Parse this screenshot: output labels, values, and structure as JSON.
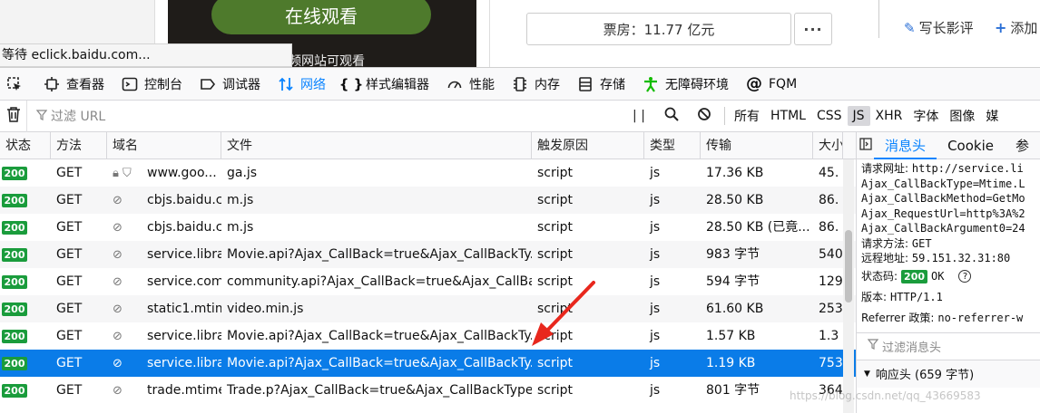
{
  "page": {
    "watch_button": "在线观看",
    "poster_text": "频网站可观看",
    "status_text": "等待 eclick.baidu.com...",
    "box_office": "票房：11.77 亿元",
    "more": "···",
    "write_review": "写长影评",
    "add": "添加"
  },
  "devtools": {
    "tabs": [
      {
        "label": "查看器",
        "icon": "inspector-icon"
      },
      {
        "label": "控制台",
        "icon": "console-icon"
      },
      {
        "label": "调试器",
        "icon": "debugger-icon"
      },
      {
        "label": "网络",
        "icon": "network-icon",
        "active": true
      },
      {
        "label": "样式编辑器",
        "icon": "style-editor-icon"
      },
      {
        "label": "性能",
        "icon": "performance-icon"
      },
      {
        "label": "内存",
        "icon": "memory-icon"
      },
      {
        "label": "存储",
        "icon": "storage-icon"
      },
      {
        "label": "无障碍环境",
        "icon": "accessibility-icon"
      },
      {
        "label": "FQM",
        "icon": "fqm-icon"
      }
    ],
    "filter_placeholder": "过滤 URL",
    "type_filters": [
      "所有",
      "HTML",
      "CSS",
      "JS",
      "XHR",
      "字体",
      "图像",
      "媒"
    ],
    "active_type_filter": "JS",
    "columns": [
      "状态",
      "方法",
      "域名",
      "文件",
      "触发原因",
      "类型",
      "传输",
      "大小"
    ],
    "rows": [
      {
        "status": "200",
        "method": "GET",
        "domain": "www.goo...",
        "file": "ga.js",
        "cause": "script",
        "type": "js",
        "transfer": "17.36 KB",
        "size": "45."
      },
      {
        "status": "200",
        "method": "GET",
        "domain": "cbjs.baidu.c...",
        "file": "m.js",
        "cause": "script",
        "type": "js",
        "transfer": "28.50 KB",
        "size": "86."
      },
      {
        "status": "200",
        "method": "GET",
        "domain": "cbjs.baidu.c...",
        "file": "m.js",
        "cause": "script",
        "type": "js",
        "transfer": "28.50 KB (已竟...",
        "size": "86."
      },
      {
        "status": "200",
        "method": "GET",
        "domain": "service.librar...",
        "file": "Movie.api?Ajax_CallBack=true&Ajax_CallBackTy...",
        "cause": "script",
        "type": "js",
        "transfer": "983 字节",
        "size": "540"
      },
      {
        "status": "200",
        "method": "GET",
        "domain": "service.com...",
        "file": "community.api?Ajax_CallBack=true&Ajax_CallBa...",
        "cause": "script",
        "type": "js",
        "transfer": "594 字节",
        "size": "129"
      },
      {
        "status": "200",
        "method": "GET",
        "domain": "static1.mtim...",
        "file": "video.min.js",
        "cause": "script",
        "type": "js",
        "transfer": "61.60 KB",
        "size": "253"
      },
      {
        "status": "200",
        "method": "GET",
        "domain": "service.librar...",
        "file": "Movie.api?Ajax_CallBack=true&Ajax_CallBackTy...",
        "cause": "script",
        "type": "js",
        "transfer": "1.57 KB",
        "size": "1.3"
      },
      {
        "status": "200",
        "method": "GET",
        "domain": "service.librar...",
        "file": "Movie.api?Ajax_CallBack=true&Ajax_CallBackTy...",
        "cause": "script",
        "type": "js",
        "transfer": "1.19 KB",
        "size": "753",
        "selected": true
      },
      {
        "status": "200",
        "method": "GET",
        "domain": "trade.mtime...",
        "file": "Trade.p?Ajax_CallBack=true&Ajax_CallBackType...",
        "cause": "script",
        "type": "js",
        "transfer": "801 字节",
        "size": "364"
      }
    ]
  },
  "details": {
    "tabs": [
      "消息头",
      "Cookie",
      "参"
    ],
    "request_url_label": "请求网址:",
    "request_url": "http://service.li",
    "url_lines": [
      "Ajax_CallBackType=Mtime.L",
      "Ajax_CallBackMethod=GetMo",
      "Ajax_RequestUrl=http%3A%2",
      "Ajax_CallBackArgument0=24"
    ],
    "method_label": "请求方法:",
    "method": "GET",
    "remote_label": "远程地址:",
    "remote": "59.151.32.31:80",
    "status_label": "状态码:",
    "status_code": "200",
    "status_text": "OK",
    "version_label": "版本:",
    "version": "HTTP/1.1",
    "referrer_label": "Referrer 政策:",
    "referrer": "no-referrer-w",
    "filter_headers": "过滤消息头",
    "response_headers": "响应头 (659 字节)"
  },
  "watermark": "https://blog.csdn.net/qq_43669583"
}
